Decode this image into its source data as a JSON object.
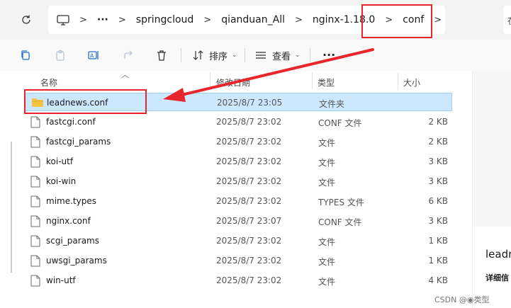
{
  "address": {
    "crumbs": [
      "springcloud",
      "qianduan_All",
      "nginx-1.18.0",
      "conf"
    ],
    "more": "···",
    "separator": ">",
    "search_partial": "在"
  },
  "toolbar": {
    "sort_label": "排序",
    "view_label": "查看",
    "more_label": "..."
  },
  "columns": {
    "name": "名称",
    "date": "修改日期",
    "type": "类型",
    "size": "大小"
  },
  "files": [
    {
      "name": "leadnews.conf",
      "date": "2025/8/7 23:05",
      "type": "文件夹",
      "size": "",
      "kind": "folder",
      "selected": true
    },
    {
      "name": "fastcgi.conf",
      "date": "2025/8/7 23:02",
      "type": "CONF 文件",
      "size": "2 KB",
      "kind": "file"
    },
    {
      "name": "fastcgi_params",
      "date": "2025/8/7 23:02",
      "type": "文件",
      "size": "2 KB",
      "kind": "file"
    },
    {
      "name": "koi-utf",
      "date": "2025/8/7 23:02",
      "type": "文件",
      "size": "3 KB",
      "kind": "file"
    },
    {
      "name": "koi-win",
      "date": "2025/8/7 23:02",
      "type": "文件",
      "size": "3 KB",
      "kind": "file"
    },
    {
      "name": "mime.types",
      "date": "2025/8/7 23:02",
      "type": "TYPES 文件",
      "size": "6 KB",
      "kind": "file"
    },
    {
      "name": "nginx.conf",
      "date": "2025/8/7 23:07",
      "type": "CONF 文件",
      "size": "3 KB",
      "kind": "file"
    },
    {
      "name": "scgi_params",
      "date": "2025/8/7 23:02",
      "type": "文件",
      "size": "1 KB",
      "kind": "file"
    },
    {
      "name": "uwsgi_params",
      "date": "2025/8/7 23:02",
      "type": "文件",
      "size": "1 KB",
      "kind": "file"
    },
    {
      "name": "win-utf",
      "date": "2025/8/7 23:02",
      "type": "文件",
      "size": "4 KB",
      "kind": "file"
    }
  ],
  "details": {
    "name_partial": "leadr",
    "info_partial": "详细信"
  },
  "watermark": "CSDN @◉类型",
  "colors": {
    "annotation": "#e8252b",
    "selection": "#cce8ff",
    "folder": "#f4c542"
  }
}
